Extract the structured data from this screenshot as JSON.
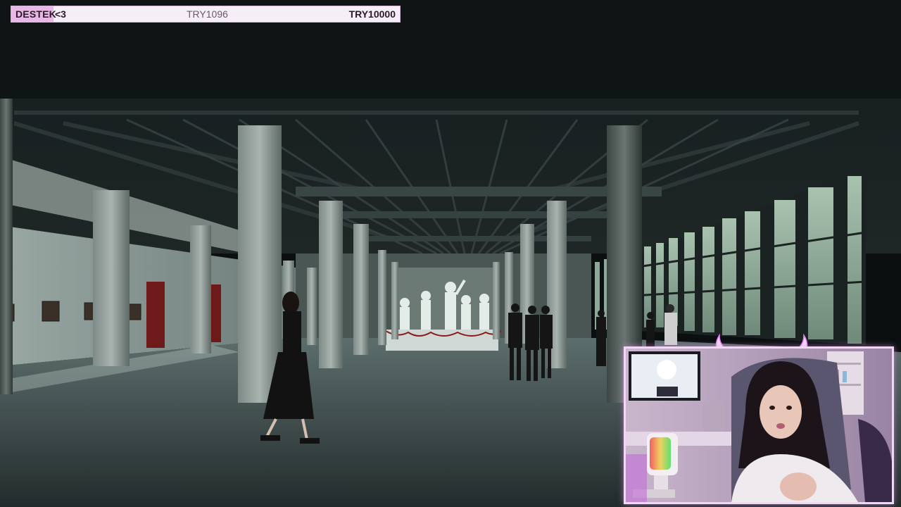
{
  "donation": {
    "label": "DESTEK",
    "heart": "<3",
    "current": "TRY1096",
    "goal": "TRY10000",
    "progress": 0.1096,
    "colors": {
      "bar_bg": "#f6eef6",
      "bar_fill": "#e8b7e6"
    }
  },
  "video": {
    "description_icons": [
      "hall-scene",
      "woman-walking",
      "statue-group"
    ]
  },
  "webcam": {
    "accent_color": "#f2d6f6",
    "overlay_icon": "devil-horns-icon"
  }
}
